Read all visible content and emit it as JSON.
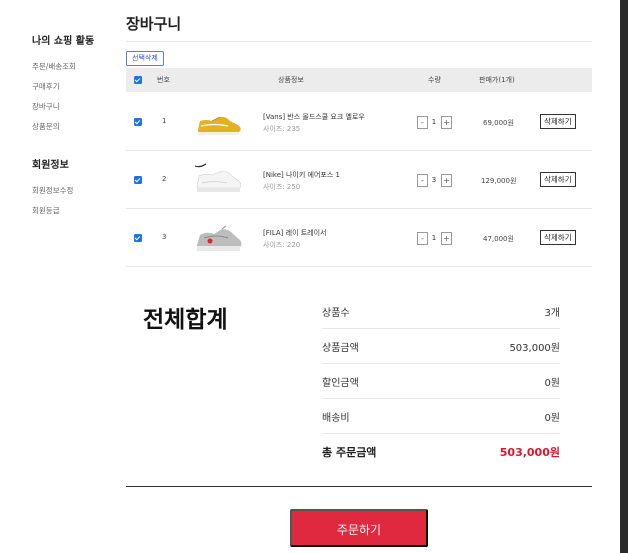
{
  "sidebar": {
    "group1_title": "나의 쇼핑 활동",
    "group1_items": [
      "주문/배송조회",
      "구매후기",
      "장바구니",
      "상품문의"
    ],
    "group2_title": "회원정보",
    "group2_items": [
      "회원정보수정",
      "회원등급"
    ]
  },
  "page_title": "장바구니",
  "delete_selected_label": "선택삭제",
  "table": {
    "headers": {
      "number": "번호",
      "product_info": "상품정보",
      "quantity": "수량",
      "price": "판매가(1개)"
    },
    "rows": [
      {
        "number": "1",
        "name": "[Vans]  반스 올드스쿨 요크 옐로우",
        "size": "사이즈: 235",
        "qty": "1",
        "price": "69,000원",
        "delete_label": "삭제하기",
        "image_icon": "yellow-sneaker-icon"
      },
      {
        "number": "2",
        "name": "[Nike]  나이키 에어포스 1",
        "size": "사이즈: 250",
        "qty": "3",
        "price": "129,000원",
        "delete_label": "삭제하기",
        "image_icon": "white-sneaker-icon"
      },
      {
        "number": "3",
        "name": "[FILA]  레이 트레이서",
        "size": "사이즈: 220",
        "qty": "1",
        "price": "47,000원",
        "delete_label": "삭제하기",
        "image_icon": "grey-running-shoe-icon"
      }
    ],
    "minus_symbol": "-",
    "plus_symbol": "+"
  },
  "summary": {
    "title": "전체합계",
    "rows": [
      {
        "label": "상품수",
        "value": "3개"
      },
      {
        "label": "상품금액",
        "value": "503,000원"
      },
      {
        "label": "할인금액",
        "value": "0원"
      },
      {
        "label": "배송비",
        "value": "0원"
      }
    ],
    "total_label": "총 주문금액",
    "total_value": "503,000원"
  },
  "order_button_label": "주문하기",
  "colors": {
    "accent_blue": "#1a73e8",
    "order_red": "#e0283e",
    "total_red": "#e0132c"
  }
}
